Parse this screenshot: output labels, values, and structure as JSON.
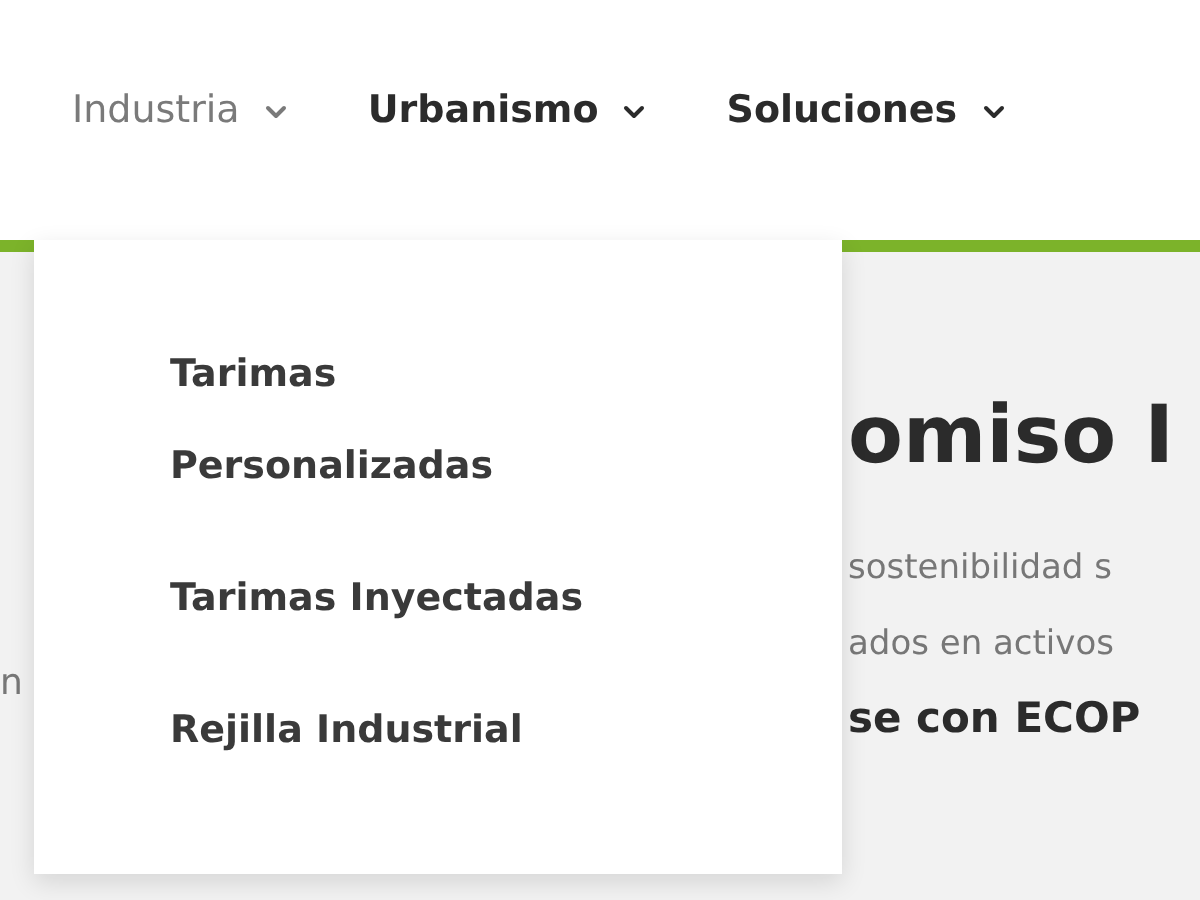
{
  "nav": [
    {
      "label": "Industria",
      "selected": true
    },
    {
      "label": "Urbanismo",
      "selected": false
    },
    {
      "label": "Soluciones",
      "selected": false
    }
  ],
  "dropdown": {
    "items": [
      "Tarimas Personalizadas",
      "Tarimas Inyectadas",
      "Rejilla Industrial"
    ]
  },
  "content": {
    "left_fragment": "n",
    "heading": "omiso I",
    "lines": [
      "sostenibilidad s",
      "ados en activos"
    ],
    "bold_line": "se con ECOP"
  }
}
